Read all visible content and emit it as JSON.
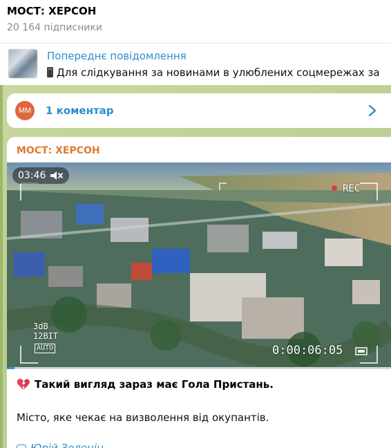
{
  "header": {
    "title": "МОСТ: ХЕРСОН",
    "subscribers": "20 164 підписники"
  },
  "previous_message": {
    "title": "Попереднє повідомлення",
    "text": "Для слідкування за новинами в улюблених соцмережах за",
    "thumb_icon": "image-thumbnail",
    "leading_icon": "mobile-phone-icon"
  },
  "comments": {
    "avatar_initials": "ММ",
    "label": "1 коментар",
    "icon": "chevron-right-icon"
  },
  "message": {
    "author": "МОСТ: ХЕРСОН",
    "video": {
      "duration": "03:46",
      "muted_icon": "speaker-muted-icon",
      "rec_label": "REC",
      "audio_label": "3dB",
      "bit_label": "12BIT",
      "auto_label": "AUTO",
      "timecode": "0:00:06:05",
      "progress": 0.02
    },
    "line1_icon": "broken-heart-icon",
    "line1": "Такий вигляд зараз має Гола Пристань.",
    "line2": "Місто, яке чекає на визволення від окупантів.",
    "line3": "Юрій Зеленін"
  },
  "colors": {
    "accent_blue": "#2a8ecc",
    "author_orange": "#e07a2f",
    "avatar": "#e0663e",
    "chat_background": "#c5d49a"
  }
}
